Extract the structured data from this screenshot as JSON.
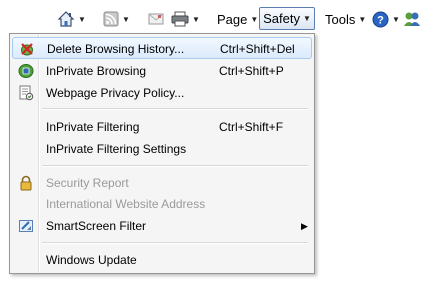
{
  "toolbar": {
    "page_label": "Page",
    "safety_label": "Safety",
    "tools_label": "Tools",
    "icons": [
      "home-icon",
      "feeds-icon",
      "read-mail-icon",
      "print-icon",
      "help-icon",
      "research-icon"
    ]
  },
  "menu": {
    "items": [
      {
        "label": "Delete Browsing History...",
        "shortcut": "Ctrl+Shift+Del",
        "icon": "delete-history-icon",
        "enabled": true,
        "highlighted": true
      },
      {
        "label": "InPrivate Browsing",
        "shortcut": "Ctrl+Shift+P",
        "icon": "inprivate-icon",
        "enabled": true
      },
      {
        "label": "Webpage Privacy Policy...",
        "shortcut": "",
        "icon": "privacy-policy-icon",
        "enabled": true
      },
      {
        "label": "InPrivate Filtering",
        "shortcut": "Ctrl+Shift+F",
        "icon": "",
        "enabled": true
      },
      {
        "label": "InPrivate Filtering Settings",
        "shortcut": "",
        "icon": "",
        "enabled": true
      },
      {
        "label": "Security Report",
        "shortcut": "",
        "icon": "lock-icon",
        "enabled": false
      },
      {
        "label": "International Website Address",
        "shortcut": "",
        "icon": "",
        "enabled": false
      },
      {
        "label": "SmartScreen Filter",
        "shortcut": "",
        "icon": "smartscreen-icon",
        "enabled": true,
        "submenu": true
      },
      {
        "label": "Windows Update",
        "shortcut": "",
        "icon": "",
        "enabled": true
      }
    ]
  },
  "colors": {
    "highlight_border": "#a8cbf1",
    "disabled_text": "#9a9a9a",
    "menu_background": "#f5f5f5"
  }
}
